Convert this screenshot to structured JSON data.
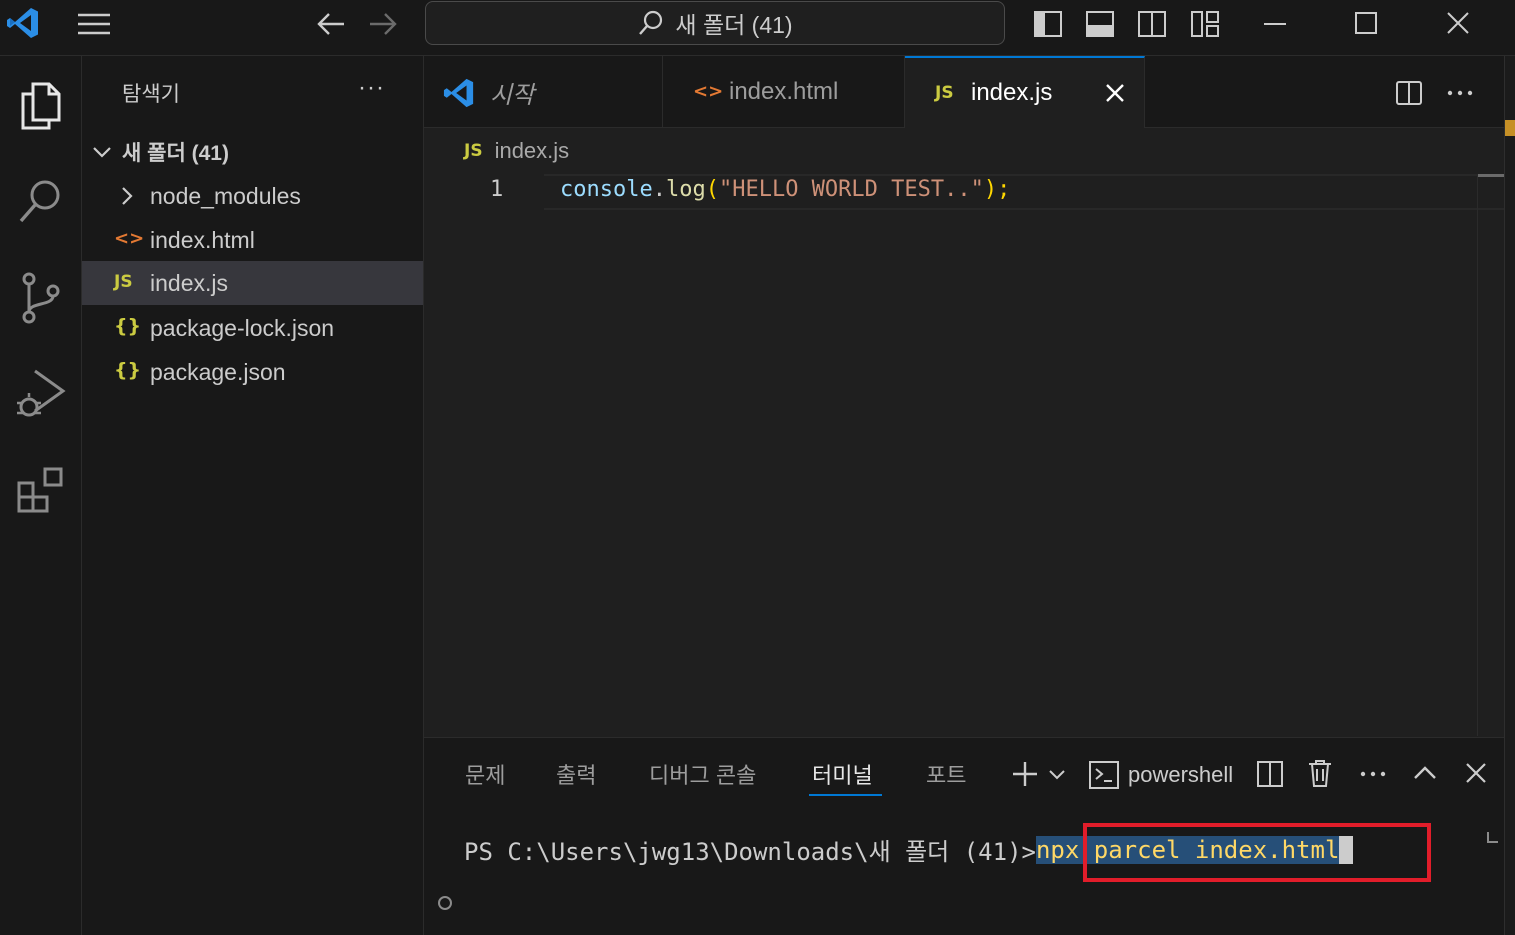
{
  "colors": {
    "accent": "#0078d4",
    "js_icon": "#cbcb41",
    "html_icon": "#e37933",
    "json_icon": "#cbcb41",
    "string": "#ce9178",
    "function": "#dcdcaa",
    "variable": "#9cdcfe",
    "highlight_border": "#e11d2a"
  },
  "titlebar": {
    "app_icon": "vscode-icon",
    "menu_icon": "hamburger-icon",
    "search_text": "새 폴더 (41)"
  },
  "activity_bar": {
    "items": [
      {
        "icon": "explorer-icon"
      },
      {
        "icon": "search-icon"
      },
      {
        "icon": "source-control-icon"
      },
      {
        "icon": "run-debug-icon"
      },
      {
        "icon": "extensions-icon"
      }
    ]
  },
  "sidebar": {
    "title": "탐색기",
    "more": "···",
    "folder": "새 폴더 (41)",
    "items": [
      {
        "label": "node_modules",
        "icon": ">"
      },
      {
        "label": "index.html",
        "icon": "<>"
      },
      {
        "label": "index.js",
        "icon": "JS"
      },
      {
        "label": "package-lock.json",
        "icon": "{}"
      },
      {
        "label": "package.json",
        "icon": "{}"
      }
    ]
  },
  "tabs": [
    {
      "label": "시작"
    },
    {
      "label": "index.html"
    },
    {
      "label": "index.js",
      "icon": "JS"
    }
  ],
  "editor": {
    "breadcrumb_icon": "JS",
    "breadcrumb": "index.js",
    "line_number": "1",
    "code": {
      "obj": "console",
      "dot": ".",
      "fn": "log",
      "open": "(",
      "str": "\"HELLO WORLD TEST..\"",
      "close": ");"
    }
  },
  "panel": {
    "tabs": [
      "문제",
      "출력",
      "디버그 콘솔",
      "터미널",
      "포트"
    ],
    "active_tab": "터미널",
    "shell": "powershell",
    "prompt": "PS C:\\Users\\jwg13\\Downloads\\새 폴더 (41)>",
    "command": "npx parcel index.html"
  }
}
